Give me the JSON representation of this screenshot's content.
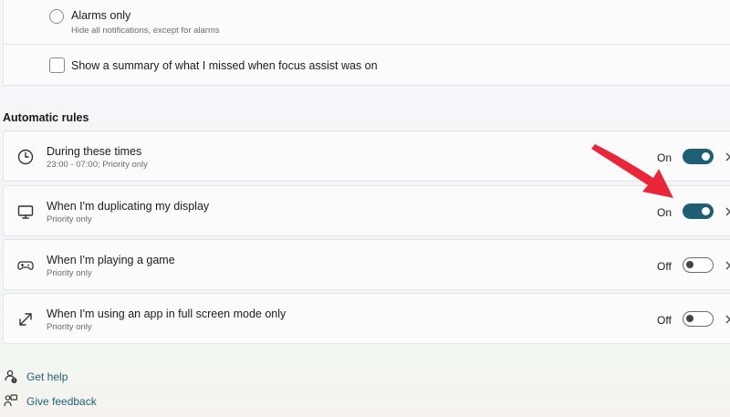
{
  "focus_options": {
    "alarms_label": "Alarms only",
    "alarms_desc": "Hide all notifications, except for alarms",
    "summary_label": "Show a summary of what I missed when focus assist was on"
  },
  "automatic_rules": {
    "heading": "Automatic rules",
    "items": [
      {
        "title": "During these times",
        "subtitle": "23:00 - 07:00; Priority only",
        "state": "On",
        "enabled": true,
        "icon": "clock-icon"
      },
      {
        "title": "When I'm duplicating my display",
        "subtitle": "Priority only",
        "state": "On",
        "enabled": true,
        "icon": "monitor-icon"
      },
      {
        "title": "When I'm playing a game",
        "subtitle": "Priority only",
        "state": "Off",
        "enabled": false,
        "icon": "gamepad-icon"
      },
      {
        "title": "When I'm using an app in full screen mode only",
        "subtitle": "Priority only",
        "state": "Off",
        "enabled": false,
        "icon": "expand-icon"
      }
    ]
  },
  "footer": {
    "help": "Get help",
    "feedback": "Give feedback"
  },
  "colors": {
    "accent": "#1e5f74",
    "annotation_arrow": "#e8283a"
  }
}
